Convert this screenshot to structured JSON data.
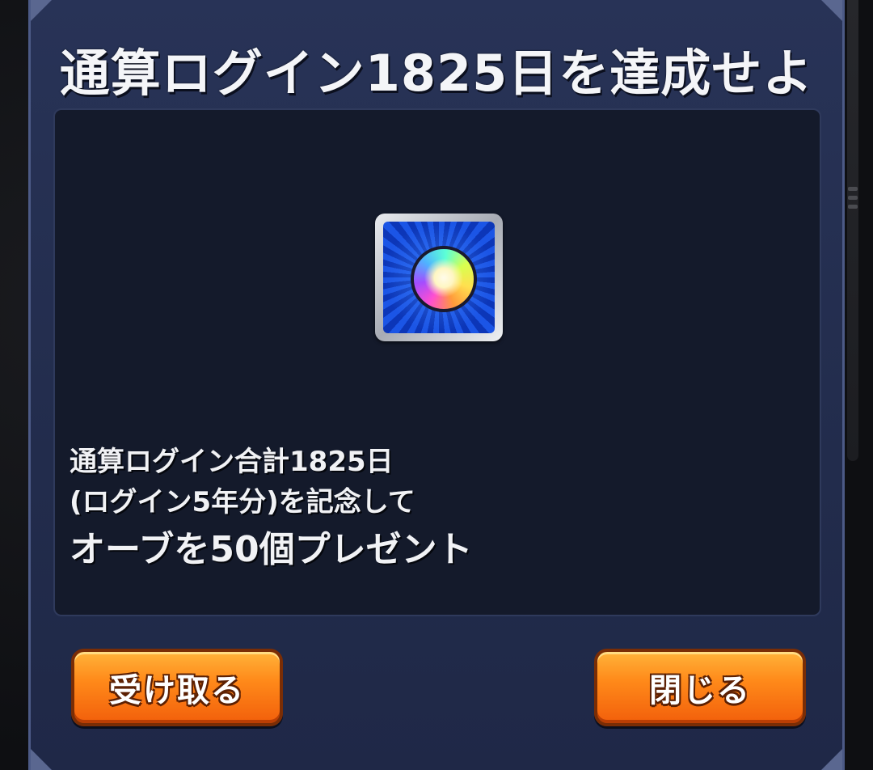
{
  "dialog": {
    "title": "通算ログイン1825日を達成せよ"
  },
  "reward": {
    "icon": "rainbow-orb-icon"
  },
  "description": {
    "line1": "通算ログイン合計1825日",
    "line2": "(ログイン5年分)を記念して",
    "line3": "オーブを50個プレゼント"
  },
  "buttons": {
    "receive_label": "受け取る",
    "close_label": "閉じる"
  },
  "colors": {
    "dialog_bg": "#283357",
    "panel_bg": "#141a2b",
    "button_orange": "#ff8a1a"
  }
}
